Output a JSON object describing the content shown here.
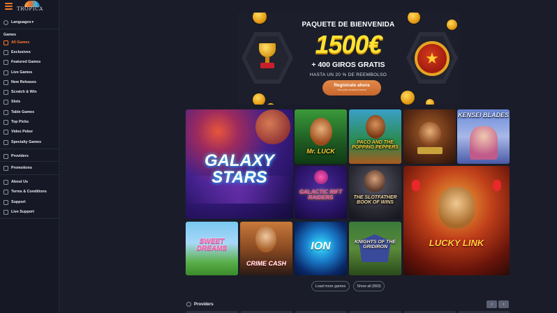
{
  "brand": {
    "logo_text": "TROPICA"
  },
  "sidebar": {
    "languages_label": "Languages",
    "games_section": "Games",
    "game_items": [
      {
        "label": "All Games",
        "icon": "horseshoe-icon",
        "active": true
      },
      {
        "label": "Exclusives",
        "icon": "exclusive-icon"
      },
      {
        "label": "Featured Games",
        "icon": "featured-icon"
      },
      {
        "label": "Live Games",
        "icon": "live-icon"
      },
      {
        "label": "New Releases",
        "icon": "new-icon"
      },
      {
        "label": "Scratch & Win",
        "icon": "scratch-icon"
      },
      {
        "label": "Slots",
        "icon": "slot-icon"
      },
      {
        "label": "Table Games",
        "icon": "table-icon"
      },
      {
        "label": "Top Picks",
        "icon": "top-picks-icon"
      },
      {
        "label": "Video Poker",
        "icon": "poker-icon"
      },
      {
        "label": "Specialty Games",
        "icon": "specialty-icon"
      }
    ],
    "providers_label": "Providers",
    "promotions_label": "Promotions",
    "info_items": [
      {
        "label": "About Us",
        "icon": "info-icon"
      },
      {
        "label": "Terms & Conditions",
        "icon": "terms-icon"
      },
      {
        "label": "Support",
        "icon": "support-icon"
      },
      {
        "label": "Live Support",
        "icon": "chat-icon"
      }
    ]
  },
  "banner": {
    "title": "PAQUETE DE BIENVENIDA",
    "amount": "1500€",
    "spins": "+ 400 GIROS GRATIS",
    "refund": "HASTA UN 20 % DE REEMBOLSO",
    "cta": "Regístrate ahora",
    "cta_sub": "Solo para usuarios nuevos"
  },
  "games": [
    {
      "name": "GALAXY STARS"
    },
    {
      "name": "Mr. LUCK"
    },
    {
      "name": "PACO AND THE POPPING PEPPERS"
    },
    {
      "name": ""
    },
    {
      "name": "KENSEI BLADES"
    },
    {
      "name": "GALACTIC RIFT RAIDERS"
    },
    {
      "name": "THE SLOTFATHER BOOK OF WINS"
    },
    {
      "name": "LUCKY LINK"
    },
    {
      "name": "SWEET DREAMS"
    },
    {
      "name": "CRIME CASH"
    },
    {
      "name": "ION"
    },
    {
      "name": "KNIGHTS OF THE GRIDIRON"
    }
  ],
  "actions": {
    "load_more": "Load more games",
    "show_all": "Show all (893)"
  },
  "providers_section": {
    "title": "Providers",
    "prev": "‹",
    "next": "›"
  }
}
